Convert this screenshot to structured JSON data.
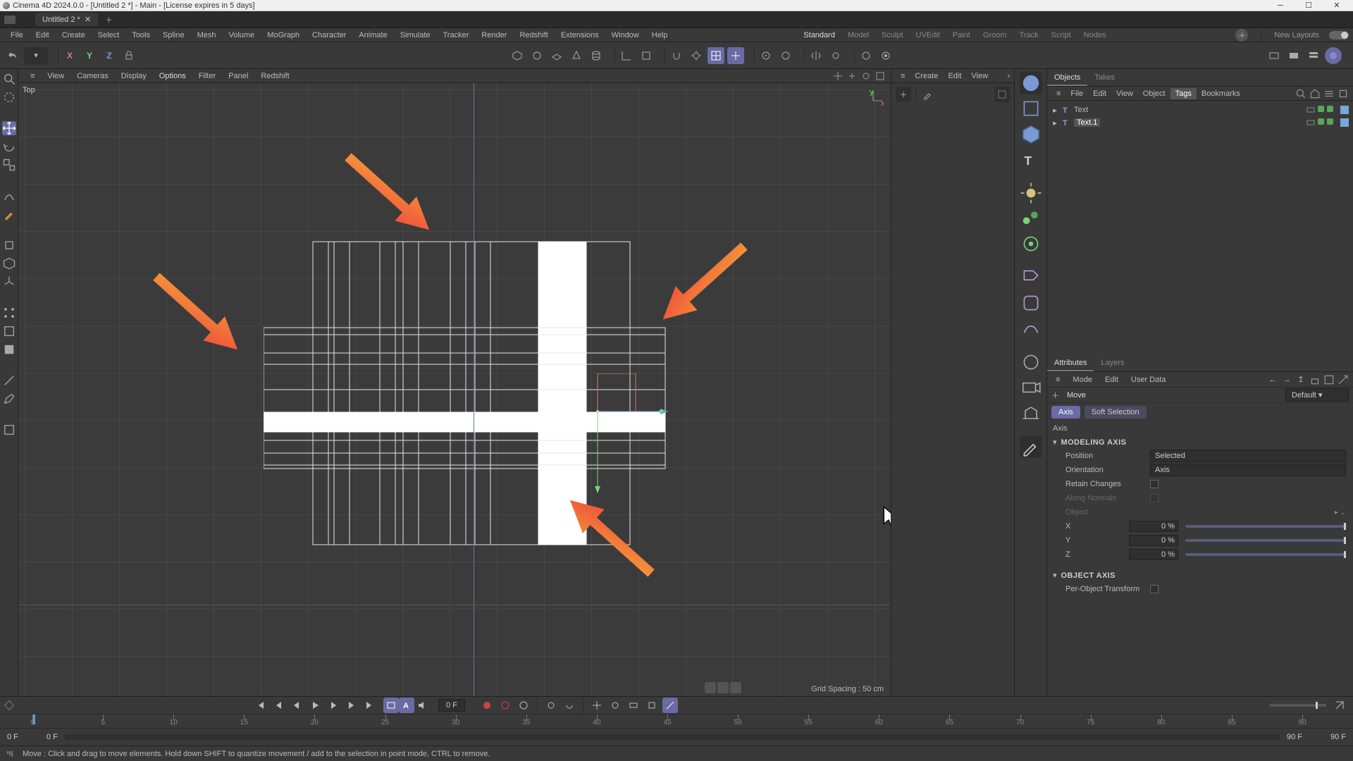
{
  "title": "Cinema 4D 2024.0.0 - [Untitled 2 *] - Main - [License expires in 5 days]",
  "doc_tab": {
    "name": "Untitled 2 *"
  },
  "menu": [
    "File",
    "Edit",
    "Create",
    "Select",
    "Tools",
    "Spline",
    "Mesh",
    "Volume",
    "MoGraph",
    "Character",
    "Animate",
    "Simulate",
    "Tracker",
    "Render",
    "Redshift",
    "Extensions",
    "Window",
    "Help"
  ],
  "layouts": [
    "Standard",
    "Model",
    "Sculpt",
    "UVEdit",
    "Paint",
    "Groom",
    "Track",
    "Script",
    "Nodes"
  ],
  "layouts_active": "Standard",
  "new_layouts": "New Layouts",
  "viewport_menu": [
    "View",
    "Cameras",
    "Display",
    "Options",
    "Filter",
    "Panel",
    "Redshift"
  ],
  "viewport_menu_active": "Options",
  "viewport_label": "Top",
  "viewport_grid_label": "Grid Spacing : 50 cm",
  "axis_letters": {
    "x": "X",
    "y": "Y",
    "z": "Z"
  },
  "mid_menu": [
    "Create",
    "Edit",
    "View"
  ],
  "objects_panel": {
    "tabs": [
      "Objects",
      "Takes"
    ],
    "active_tab": "Objects",
    "menubar": [
      "File",
      "Edit",
      "View",
      "Object",
      "Tags",
      "Bookmarks"
    ],
    "menubar_hl": "Tags",
    "items": [
      {
        "name": "Text",
        "selected": false
      },
      {
        "name": "Text.1",
        "selected": true
      }
    ]
  },
  "attributes_panel": {
    "tabs": [
      "Attributes",
      "Layers"
    ],
    "active_tab": "Attributes",
    "head_menu": [
      "Mode",
      "Edit",
      "User Data"
    ],
    "tool": {
      "name": "Move",
      "preset": "Default"
    },
    "subtabs": [
      "Axis",
      "Soft Selection"
    ],
    "subtab_active": "Axis",
    "subtab_label": "Axis",
    "sections": {
      "modeling_axis": {
        "title": "MODELING AXIS",
        "position_label": "Position",
        "position_value": "Selected",
        "orientation_label": "Orientation",
        "orientation_value": "Axis",
        "retain_label": "Retain Changes",
        "along_normals_label": "Along Normals",
        "object_label": "Object",
        "x_label": "X",
        "x_value": "0 %",
        "y_label": "Y",
        "y_value": "0 %",
        "z_label": "Z",
        "z_value": "0 %"
      },
      "object_axis": {
        "title": "OBJECT AXIS",
        "per_object_label": "Per-Object Transform"
      }
    }
  },
  "timeline": {
    "current_frame": "0 F",
    "ticks": [
      "0",
      "5",
      "10",
      "15",
      "20",
      "25",
      "30",
      "35",
      "40",
      "45",
      "50",
      "55",
      "60",
      "65",
      "70",
      "75",
      "80",
      "85",
      "90"
    ],
    "range_start_a": "0 F",
    "range_start_b": "0 F",
    "range_end_a": "90 F",
    "range_end_b": "90 F"
  },
  "statusbar_text": "Move : Click and drag to move elements. Hold down SHIFT to quantize movement / add to the selection in point mode, CTRL to remove."
}
